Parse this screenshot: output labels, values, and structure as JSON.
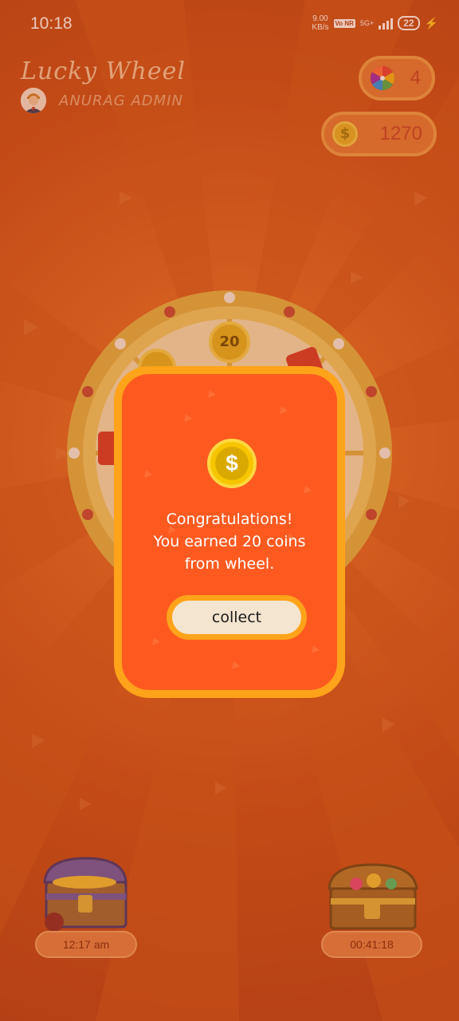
{
  "status_bar": {
    "time": "10:18",
    "net_speed_top": "9.00",
    "net_speed_bottom": "KB/s",
    "volte": "Vo NR",
    "network": "5G+",
    "battery": "22"
  },
  "header": {
    "title": "Lucky Wheel",
    "user_name": "ANURAG ADMIN",
    "spins_count": "4",
    "coins_balance": "1270"
  },
  "wheel": {
    "visible_segment_label": "20"
  },
  "reward_dialog": {
    "coin_symbol": "$",
    "message_line1": "Congratulations!",
    "message_line2": "You earned 20 coins",
    "message_line3": "from wheel.",
    "collect_label": "collect"
  },
  "chests": {
    "left_timer": "12:17 am",
    "right_timer": "00:41:18"
  },
  "colors": {
    "dialog_background": "#fe5a20",
    "dialog_border": "#ffa31a",
    "button_background": "#f3e5cf",
    "coin_gold": "#f7c600"
  }
}
